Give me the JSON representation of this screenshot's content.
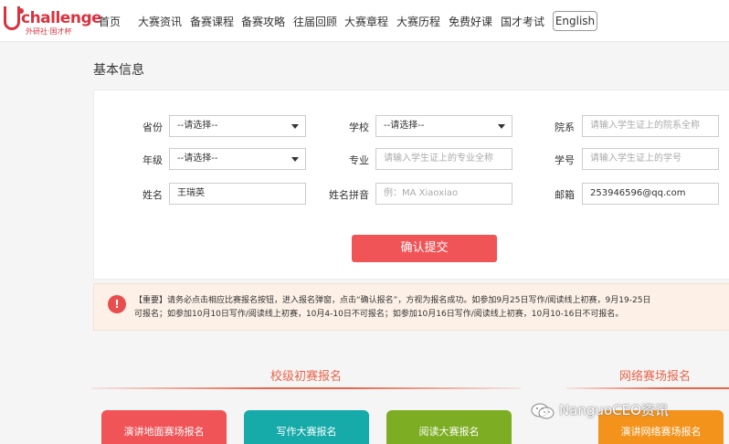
{
  "header": {
    "logo": {
      "text": "challenge",
      "subtitle": "外研社·国才杯"
    },
    "nav": [
      "首页",
      "大赛资讯",
      "备赛课程",
      "备赛攻略",
      "往届回顾",
      "大赛章程",
      "大赛历程",
      "免费好课",
      "国才考试"
    ],
    "language_button": "English"
  },
  "form": {
    "section_title": "基本信息",
    "province": {
      "label": "省份",
      "value": "--请选择--"
    },
    "school": {
      "label": "学校",
      "value": "--请选择--"
    },
    "college": {
      "label": "院系",
      "placeholder": "请输入学生证上的院系全称"
    },
    "grade": {
      "label": "年级",
      "value": "--请选择--"
    },
    "major": {
      "label": "专业",
      "placeholder": "请输入学生证上的专业全称"
    },
    "student_id": {
      "label": "学号",
      "placeholder": "请输入学生证上的学号"
    },
    "name": {
      "label": "姓名",
      "value": "王瑞英"
    },
    "pinyin": {
      "label": "姓名拼音",
      "placeholder": "例：MA Xiaoxiao"
    },
    "email": {
      "label": "邮箱",
      "value": "253946596@qq.com"
    },
    "submit_label": "确认提交"
  },
  "notice": {
    "icon": "!",
    "line1": "【重要】请务必点击相应比赛报名按钮，进入报名弹窗，点击“确认报名”，方视为报名成功。如参加9月25日写作/阅读线上初赛，9月19-25日",
    "line2": "可报名；如参加10月10日写作/阅读线上初赛，10月4-10日不可报名；如参加10月16日写作/阅读线上初赛，10月10-16日不可报名。"
  },
  "categories": {
    "school_title": "校级初赛报名",
    "online_title": "网络赛场报名"
  },
  "cards": [
    {
      "label": "演讲地面赛场报名",
      "color": "#f15457"
    },
    {
      "label": "写作大赛报名",
      "color": "#16aaa9"
    },
    {
      "label": "阅读大赛报名",
      "color": "#7cad22"
    },
    {
      "label": "演讲网络赛场报名",
      "color": "#f3931c"
    }
  ],
  "watermark": {
    "text": "NanguoCEO资讯",
    "icon": "wechat-icon"
  },
  "colors": {
    "accent": "#f15457",
    "brand": "#d9333f",
    "title": "#e8654a"
  }
}
